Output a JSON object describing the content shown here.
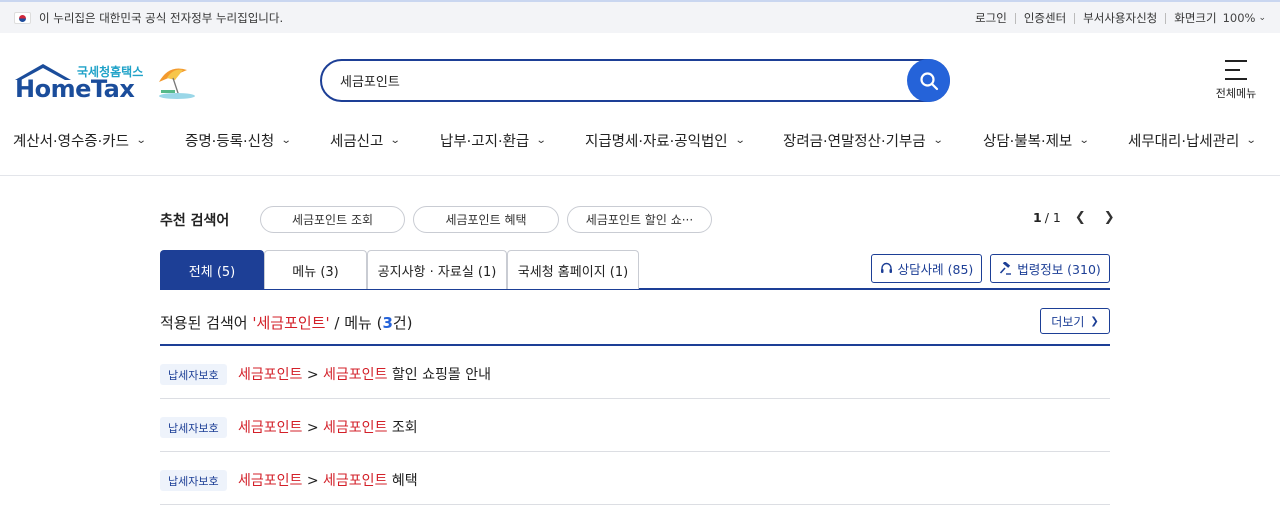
{
  "topbar": {
    "gov_notice": "이 누리집은 대한민국 공식 전자정부 누리집입니다.",
    "links": [
      "로그인",
      "인증센터",
      "부서사용자신청"
    ],
    "zoom_label": "화면크기",
    "zoom_value": "100%"
  },
  "logo": {
    "sub": "국세청홈택스",
    "main": "HomeTax"
  },
  "search": {
    "value": "세금포인트"
  },
  "all_menu": {
    "label": "전체메뉴"
  },
  "gnb": [
    "계산서·영수증·카드",
    "증명·등록·신청",
    "세금신고",
    "납부·고지·환급",
    "지급명세·자료·공익법인",
    "장려금·연말정산·기부금",
    "상담·불복·제보",
    "세무대리·납세관리"
  ],
  "recommend": {
    "label": "추천 검색어",
    "chips": [
      "세금포인트 조회",
      "세금포인트 혜택",
      "세금포인트 할인 쇼···"
    ],
    "page_current": "1",
    "page_total": "/ 1"
  },
  "tabs": [
    "전체 (5)",
    "메뉴 (3)",
    "공지사항 · 자료실 (1)",
    "국세청 홈페이지 (1)"
  ],
  "side_buttons": [
    "상담사례 (85)",
    "법령정보 (310)"
  ],
  "applied": {
    "prefix": "적용된 검색어",
    "keyword": "'세금포인트'",
    "middle": "/ 메뉴 (",
    "count": "3",
    "suffix": "건)"
  },
  "more_label": "더보기",
  "results": [
    {
      "tag": "납세자보호",
      "kw1": "세금포인트",
      "sep": " > ",
      "kw2": "세금포인트",
      "rest": " 할인 쇼핑몰 안내"
    },
    {
      "tag": "납세자보호",
      "kw1": "세금포인트",
      "sep": " > ",
      "kw2": "세금포인트",
      "rest": " 조회"
    },
    {
      "tag": "납세자보호",
      "kw1": "세금포인트",
      "sep": " > ",
      "kw2": "세금포인트",
      "rest": " 혜택"
    }
  ],
  "colors": {
    "navy": "#1d3f96",
    "accent_blue": "#2563d9",
    "keyword_red": "#d32029"
  }
}
